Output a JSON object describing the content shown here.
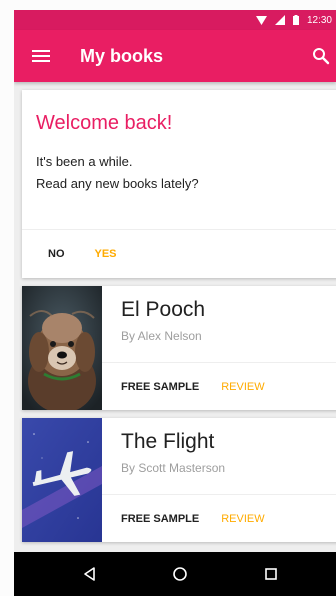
{
  "status_bar": {
    "time": "12:30",
    "icons": [
      "wifi-icon",
      "signal-icon",
      "battery-icon"
    ],
    "color": "#d81b60"
  },
  "app_bar": {
    "title": "My books",
    "color": "#e91e63",
    "icons": [
      "menu-icon",
      "search-icon"
    ]
  },
  "welcome_card": {
    "title": "Welcome back!",
    "line1": "It's been a while.",
    "line2": "Read any new books lately?",
    "no_label": "NO",
    "yes_label": "YES",
    "accent": "#ffab00"
  },
  "books": [
    {
      "title": "El Pooch",
      "author": "By Alex Nelson",
      "sample_label": "FREE SAMPLE",
      "review_label": "REVIEW",
      "cover": "dog-cover-image"
    },
    {
      "title": "The Flight",
      "author": "By Scott Masterson",
      "sample_label": "FREE SAMPLE",
      "review_label": "REVIEW",
      "cover": "airplane-cover-image"
    }
  ],
  "nav_bar": {
    "icons": [
      "back-icon",
      "home-icon",
      "recents-icon"
    ]
  }
}
